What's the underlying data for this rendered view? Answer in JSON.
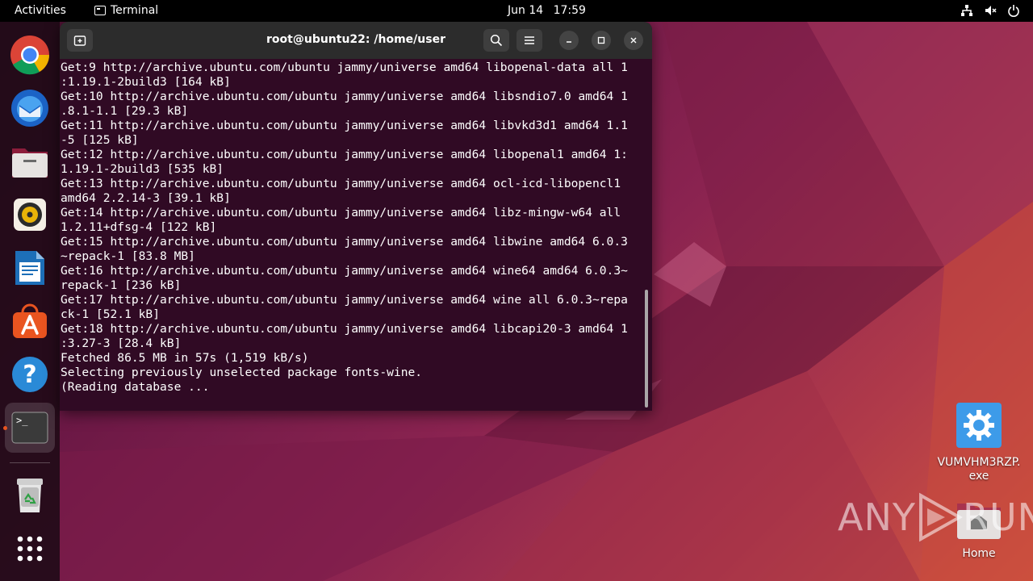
{
  "topbar": {
    "activities": "Activities",
    "app_name": "Terminal",
    "date": "Jun 14",
    "time": "17:59"
  },
  "dock": {
    "items": [
      {
        "name": "chrome",
        "icon": "chrome-icon"
      },
      {
        "name": "thunderbird",
        "icon": "thunderbird-icon"
      },
      {
        "name": "files",
        "icon": "files-icon"
      },
      {
        "name": "rhythmbox",
        "icon": "rhythmbox-icon"
      },
      {
        "name": "libreoffice-writer",
        "icon": "writer-icon"
      },
      {
        "name": "app-center",
        "icon": "app-center-icon"
      },
      {
        "name": "help",
        "icon": "help-icon",
        "glyph": "?"
      },
      {
        "name": "terminal",
        "icon": "terminal-icon",
        "glyph": ">_",
        "active": true
      },
      {
        "name": "trash",
        "icon": "trash-icon"
      },
      {
        "name": "show-apps",
        "icon": "grid-icon"
      }
    ]
  },
  "terminal": {
    "title": "root@ubuntu22: /home/user",
    "lines": [
      "Get:9 http://archive.ubuntu.com/ubuntu jammy/universe amd64 libopenal-data all 1",
      ":1.19.1-2build3 [164 kB]",
      "Get:10 http://archive.ubuntu.com/ubuntu jammy/universe amd64 libsndio7.0 amd64 1",
      ".8.1-1.1 [29.3 kB]",
      "Get:11 http://archive.ubuntu.com/ubuntu jammy/universe amd64 libvkd3d1 amd64 1.1",
      "-5 [125 kB]",
      "Get:12 http://archive.ubuntu.com/ubuntu jammy/universe amd64 libopenal1 amd64 1:",
      "1.19.1-2build3 [535 kB]",
      "Get:13 http://archive.ubuntu.com/ubuntu jammy/universe amd64 ocl-icd-libopencl1",
      "amd64 2.2.14-3 [39.1 kB]",
      "Get:14 http://archive.ubuntu.com/ubuntu jammy/universe amd64 libz-mingw-w64 all",
      "1.2.11+dfsg-4 [122 kB]",
      "Get:15 http://archive.ubuntu.com/ubuntu jammy/universe amd64 libwine amd64 6.0.3",
      "~repack-1 [83.8 MB]",
      "Get:16 http://archive.ubuntu.com/ubuntu jammy/universe amd64 wine64 amd64 6.0.3~",
      "repack-1 [236 kB]",
      "Get:17 http://archive.ubuntu.com/ubuntu jammy/universe amd64 wine all 6.0.3~repa",
      "ck-1 [52.1 kB]",
      "Get:18 http://archive.ubuntu.com/ubuntu jammy/universe amd64 libcapi20-3 amd64 1",
      ":3.27-3 [28.4 kB]",
      "Fetched 86.5 MB in 57s (1,519 kB/s)",
      "Selecting previously unselected package fonts-wine.",
      "(Reading database ... "
    ]
  },
  "desktop_icons": [
    {
      "label_line1": "VUMVHM3RZP.",
      "label_line2": "exe",
      "icon": "gear-icon"
    },
    {
      "label_line1": "Home",
      "label_line2": "",
      "icon": "home-folder-icon"
    }
  ],
  "watermark": {
    "text_left": "ANY",
    "text_right": "RUN"
  },
  "colors": {
    "terminal_bg": "#300a24",
    "header_bg": "#2c2c2c",
    "accent": "#e95420"
  }
}
